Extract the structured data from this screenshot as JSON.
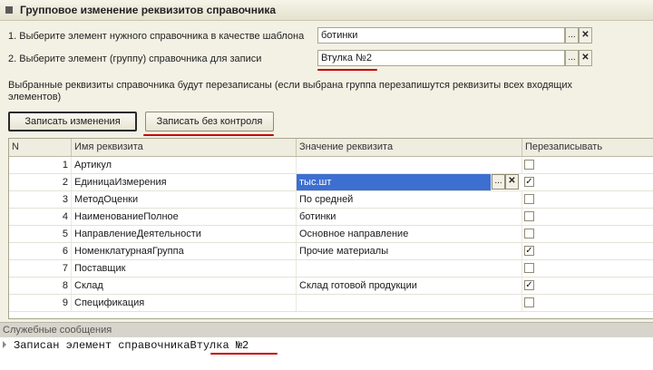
{
  "window": {
    "title": "Групповое изменение реквизитов  справочника"
  },
  "step1": {
    "label": "1. Выберите элемент нужного справочника в качестве шаблона",
    "value": "ботинки"
  },
  "step2": {
    "label": "2. Выберите  элемент  (группу)  справочника  для  записи",
    "value": "Втулка №2"
  },
  "note": "Выбранные реквизиты   справочника будут перезаписаны (если выбрана группа  перезапишутся реквизиты всех входящих элементов)",
  "buttons": {
    "write_changes": "Записать изменения",
    "write_no_control": "Записать без контроля",
    "select": "...",
    "clear": "✕"
  },
  "table": {
    "columns": [
      "N",
      "Имя реквизита",
      "Значение реквизита",
      "Перезаписывать"
    ],
    "rows": [
      {
        "n": "1",
        "name": "Артикул",
        "value": "",
        "checked": false
      },
      {
        "n": "2",
        "name": "ЕдиницаИзмерения",
        "value": "тыс.шт",
        "checked": true
      },
      {
        "n": "3",
        "name": "МетодОценки",
        "value": "По средней",
        "checked": false
      },
      {
        "n": "4",
        "name": "НаименованиеПолное",
        "value": "ботинки",
        "checked": false
      },
      {
        "n": "5",
        "name": "НаправлениеДеятельности",
        "value": "Основное направление",
        "checked": false
      },
      {
        "n": "6",
        "name": "НоменклатурнаяГруппа",
        "value": "Прочие материалы",
        "checked": true
      },
      {
        "n": "7",
        "name": "Поставщик",
        "value": "",
        "checked": false
      },
      {
        "n": "8",
        "name": "Склад",
        "value": "Склад готовой продукции",
        "checked": true
      },
      {
        "n": "9",
        "name": "Спецификация",
        "value": "",
        "checked": false
      }
    ]
  },
  "messages": {
    "header": "Служебные сообщения",
    "items": [
      {
        "prefix": "Записан элемент справочника",
        "element": "Втулка №2"
      }
    ]
  },
  "colors": {
    "underline": "#c40000",
    "selection": "#3d6fd1"
  }
}
